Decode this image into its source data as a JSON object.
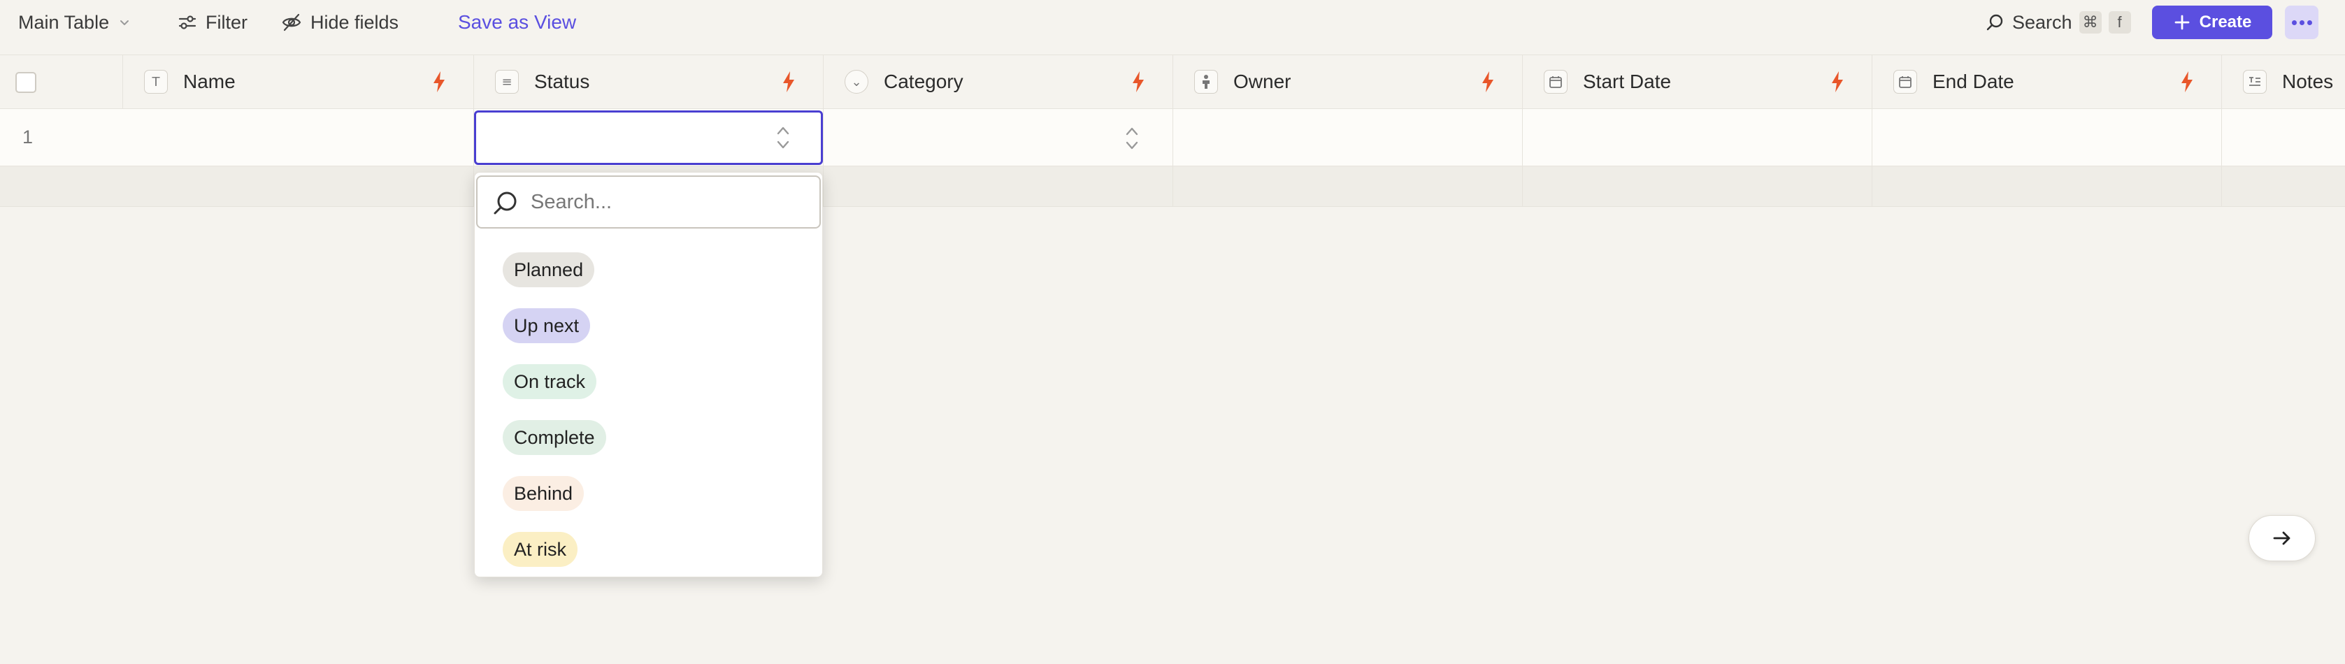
{
  "toolbar": {
    "view_name": "Main Table",
    "filter_label": "Filter",
    "hide_fields_label": "Hide fields",
    "save_view_label": "Save as View",
    "search_label": "Search",
    "shortcut_keys": [
      "⌘",
      "f"
    ],
    "create_label": "Create"
  },
  "columns": [
    {
      "label": "Name",
      "icon": "text-type-icon"
    },
    {
      "label": "Status",
      "icon": "list-icon"
    },
    {
      "label": "Category",
      "icon": "circle-check-icon"
    },
    {
      "label": "Owner",
      "icon": "person-icon"
    },
    {
      "label": "Start Date",
      "icon": "calendar-icon"
    },
    {
      "label": "End Date",
      "icon": "calendar-icon"
    },
    {
      "label": "Notes",
      "icon": "long-text-icon"
    }
  ],
  "rows": [
    {
      "number": "1"
    }
  ],
  "status_dropdown": {
    "search_placeholder": "Search...",
    "options": [
      {
        "label": "Planned",
        "color": "#e7e5e0"
      },
      {
        "label": "Up next",
        "color": "#d5d3f3"
      },
      {
        "label": "On track",
        "color": "#dff1e6"
      },
      {
        "label": "Complete",
        "color": "#e1efe5"
      },
      {
        "label": "Behind",
        "color": "#fbeee3"
      },
      {
        "label": "At risk",
        "color": "#fbefc4"
      }
    ]
  },
  "colors": {
    "accent": "#5b4fe0",
    "bolt": "#e8562a",
    "background": "#f5f3ee"
  }
}
